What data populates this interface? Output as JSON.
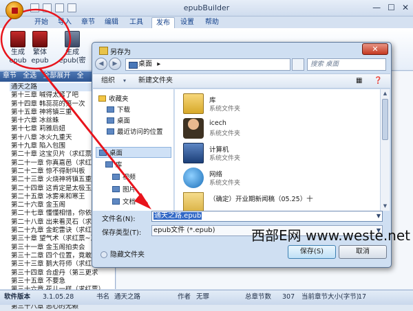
{
  "app": {
    "title": "epubBuilder",
    "window_controls": [
      "—",
      "☐",
      "✕"
    ]
  },
  "ribbon": {
    "tabs": [
      "开始",
      "导入",
      "章节",
      "编辑",
      "工具",
      "发布",
      "设置",
      "帮助"
    ],
    "active_tab": "发布",
    "buttons": [
      {
        "label_line1": "生成",
        "label_line2": "epub",
        "icon": "red-epub-icon"
      },
      {
        "label_line1": "繁体",
        "label_line2": "epub",
        "icon": "red-epub-icon"
      },
      {
        "label_line1": "生成epub(密",
        "label_line2": "",
        "icon": "book-icon"
      }
    ]
  },
  "left_panel": {
    "toolbar": [
      "章节",
      "全选",
      "全部展开",
      "全"
    ],
    "root": "通天之路",
    "chapters": [
      "第十三章  喊得太紧了吧",
      "第十四章  韩蕊蕊的第一次",
      "第十五章  神将镇三重",
      "第十六章  冰丝蛛",
      "第十七章  莉雅后妞",
      "第十八章  冰火九重天",
      "第十九章  陷入包围",
      "第二十章  这宝贝片（求红票）",
      "第二十一章  你真嘉邑（求红票）",
      "第二十二章  惊不得耐叫板",
      "第二十三章  火烧神将镇五重",
      "第二十四章  这肯定是太极玉符",
      "第二十五章  冰雾来和寒王",
      "第二十六章  金玉阁",
      "第二十七章  懂懂相惜，你依",
      "第二十八章  出来看灵石（求红",
      "第二十九章  金蛇雷诀（求红票）",
      "第三十章  望气术（求红票~）",
      "第三十一章  金玉阁拍卖会",
      "第三十二章  四个位置，竟敢",
      "第三十三章  鹅大符师（求红票）",
      "第三十四章  合虚丹（第三更求",
      "第三十五章  不要急",
      "第三十六章  花儿一样（求红票）",
      "第三十七章  答应的条件（求红票~）",
      "第三十八章  恶心的无赖"
    ]
  },
  "status_bar": {
    "version_label": "软件版本",
    "version": "3.1.05.28",
    "book_label": "书名",
    "book": "通天之路",
    "author_label": "作者",
    "author": "无罪",
    "total_label": "总章节数",
    "total": "307",
    "size_label": "当前章节大小(字节)",
    "size": "17"
  },
  "dialog": {
    "title": "另存为",
    "close": "✕",
    "address": "桌面",
    "address_arrow": "▸",
    "search_placeholder": "搜索 桌面",
    "organize": "组织",
    "new_folder": "新建文件夹",
    "nav_items": [
      "收藏夹",
      "下载",
      "桌面",
      "最近访问的位置",
      "桌面",
      "库",
      "视频",
      "图片",
      "文档"
    ],
    "files": [
      {
        "name": "库",
        "desc": "系统文件夹",
        "icon": "library-icon"
      },
      {
        "name": "icech",
        "desc": "系统文件夹",
        "icon": "user-folder-icon"
      },
      {
        "name": "计算机",
        "desc": "系统文件夹",
        "icon": "computer-icon"
      },
      {
        "name": "网络",
        "desc": "系统文件夹",
        "icon": "network-icon"
      },
      {
        "name": "（确定）开业期新闻稿（05.25）十",
        "desc": "",
        "icon": "folder-icon"
      }
    ],
    "filename_label": "文件名(N):",
    "filename_value": "通天之路.epub",
    "filetype_label": "保存类型(T):",
    "filetype_value": "epub文件 (*.epub)",
    "hide_folders": "隐藏文件夹",
    "save_button": "保存(S)",
    "cancel_button": "取消"
  },
  "watermark": "西部E网 www.weste.net",
  "annotation_color": "#e8141c"
}
